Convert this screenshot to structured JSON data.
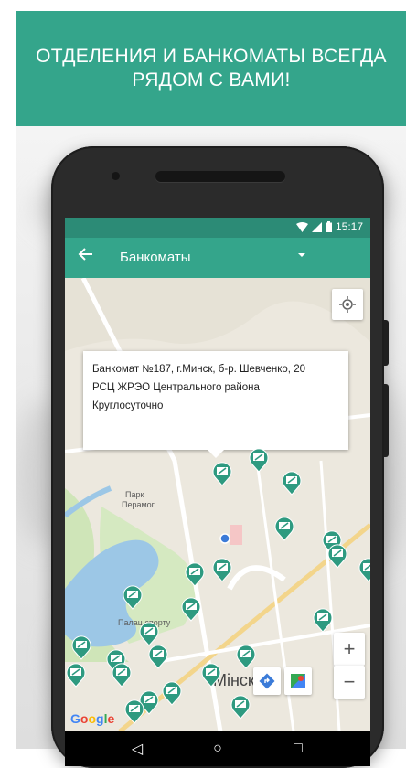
{
  "promo": {
    "line1": "ОТДЕЛЕНИЯ И БАНКОМАТЫ ВСЕГДА",
    "line2": "РЯДОМ С ВАМИ!",
    "bg": "#34a58b"
  },
  "status": {
    "time": "15:17"
  },
  "appbar": {
    "title": "Банкоматы",
    "color": "#34a58b",
    "back_icon": "arrow-left-icon",
    "dropdown_icon": "caret-down-icon"
  },
  "info": {
    "line1": "Банкомат №187, г.Минск, б-р. Шевченко, 20",
    "line2": "РСЦ ЖРЭО Центрального района",
    "line3": "Круглосуточно"
  },
  "map": {
    "labels": {
      "park": "Парк",
      "park2": "Перамог",
      "palace": "Палац спорту",
      "city": "Мінск"
    },
    "zoom_in": "+",
    "zoom_out": "−",
    "google": "Google"
  },
  "nav": {
    "back": "◁",
    "home": "○",
    "recents": "□"
  }
}
